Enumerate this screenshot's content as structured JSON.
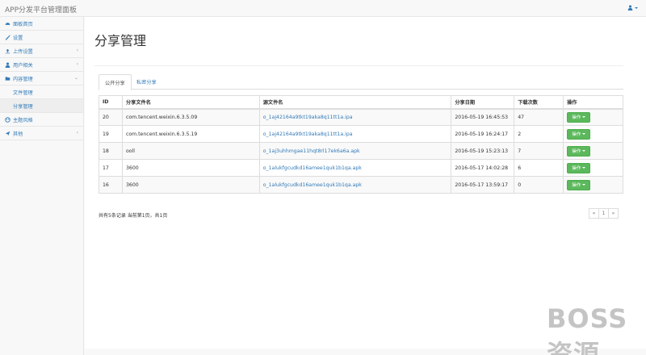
{
  "navbar": {
    "brand": "APP分发平台管理面板",
    "user_icon": "user-icon"
  },
  "sidebar": {
    "items": [
      {
        "label": "面板首页",
        "icon": "dashboard-icon",
        "arrow": ""
      },
      {
        "label": "设置",
        "icon": "wrench-icon",
        "arrow": ""
      },
      {
        "label": "上传设置",
        "icon": "upload-icon",
        "arrow": "‹"
      },
      {
        "label": "用户相关",
        "icon": "user-icon",
        "arrow": "‹"
      },
      {
        "label": "内容管理",
        "icon": "folder-icon",
        "arrow": "⌄"
      }
    ],
    "subitems": [
      {
        "label": "文件管理"
      },
      {
        "label": "分享管理"
      }
    ],
    "more": [
      {
        "label": "主题风格",
        "icon": "palette-icon",
        "arrow": ""
      },
      {
        "label": "其他",
        "icon": "send-icon",
        "arrow": "‹"
      }
    ]
  },
  "main": {
    "title": "分享管理",
    "tabs": [
      {
        "label": "公开分享"
      },
      {
        "label": "私密分享"
      }
    ],
    "table": {
      "headers": [
        "ID",
        "分享文件名",
        "源文件名",
        "分享日期",
        "下载次数",
        "操作"
      ],
      "rows": [
        {
          "id": "20",
          "share_name": "com.tencent.weixin.6.3.5.09",
          "source": "o_1aj42164a9tkt19aka8q11tt1a.ipa",
          "date": "2016-05-19 16:45:53",
          "downloads": "47",
          "action": "操作"
        },
        {
          "id": "19",
          "share_name": "com.tencent.weixin.6.3.5.19",
          "source": "o_1aj42164a9tkt19aka8q11tt1a.ipa",
          "date": "2016-05-19 16:24:17",
          "downloads": "2",
          "action": "操作"
        },
        {
          "id": "18",
          "share_name": "ooll",
          "source": "o_1aj3uhhmgae11hqt8rl17ek6a6a.apk",
          "date": "2016-05-19 15:23:13",
          "downloads": "7",
          "action": "操作"
        },
        {
          "id": "17",
          "share_name": "3600",
          "source": "o_1alukfgcudkd16amee1quk1b1qa.apk",
          "date": "2016-05-17 14:02:28",
          "downloads": "6",
          "action": "操作"
        },
        {
          "id": "16",
          "share_name": "3600",
          "source": "o_1alukfgcudkd16amee1quk1b1qa.apk",
          "date": "2016-05-17 13:59:17",
          "downloads": "0",
          "action": "操作"
        }
      ]
    },
    "summary": "共有5条记录  当前第1页，共1页",
    "pager": {
      "prev": "«",
      "current": "1",
      "next": "»"
    }
  },
  "watermark": "BOSS 资源",
  "colors": {
    "link": "#337ab7",
    "success": "#5cb85c",
    "border": "#dddddd"
  }
}
